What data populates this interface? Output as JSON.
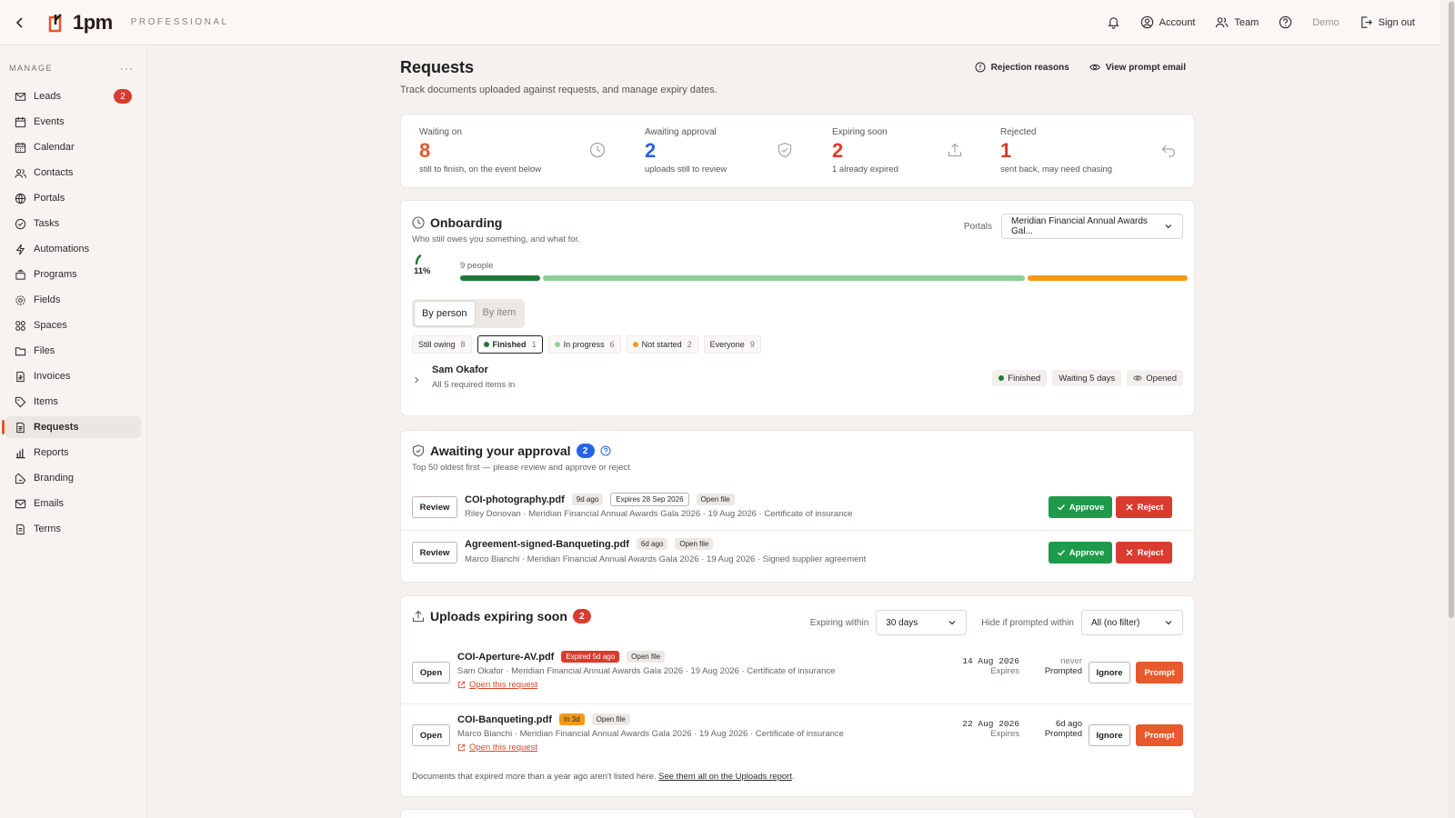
{
  "topbar": {
    "logo_text": "1pm",
    "logo_sub": "PROFESSIONAL",
    "account": "Account",
    "team": "Team",
    "demo": "Demo",
    "sign_out": "Sign out"
  },
  "sidebar": {
    "section": "MANAGE",
    "more": "···",
    "items": [
      {
        "label": "Leads",
        "badge": "2"
      },
      {
        "label": "Events"
      },
      {
        "label": "Calendar"
      },
      {
        "label": "Contacts"
      },
      {
        "label": "Portals"
      },
      {
        "label": "Tasks"
      },
      {
        "label": "Automations"
      },
      {
        "label": "Programs"
      },
      {
        "label": "Fields"
      },
      {
        "label": "Spaces"
      },
      {
        "label": "Files"
      },
      {
        "label": "Invoices"
      },
      {
        "label": "Items"
      },
      {
        "label": "Requests"
      },
      {
        "label": "Reports"
      },
      {
        "label": "Branding"
      },
      {
        "label": "Emails"
      },
      {
        "label": "Terms"
      }
    ]
  },
  "page": {
    "title": "Requests",
    "subtitle": "Track documents uploaded against requests, and manage expiry dates.",
    "rejection_reasons": "Rejection reasons",
    "view_prompt_email": "View prompt email"
  },
  "stats": [
    {
      "label": "Waiting on",
      "value": "8",
      "desc": "still to finish, on the event below",
      "color": "#e1572b"
    },
    {
      "label": "Awaiting approval",
      "value": "2",
      "desc": "uploads still to review",
      "color": "#2563eb"
    },
    {
      "label": "Expiring soon",
      "value": "2",
      "desc": "1 already expired",
      "color": "#d93b2f"
    },
    {
      "label": "Rejected",
      "value": "1",
      "desc": "sent back, may need chasing",
      "color": "#d93b2f"
    }
  ],
  "onboarding": {
    "title": "Onboarding",
    "subtitle": "Who still owes you something, and what for.",
    "portals_label": "Portals",
    "portal_value": "Meridian Financial Annual Awards Gal...",
    "progress_pct": "11%",
    "progress_value": 0.11,
    "people": "9 people",
    "bar": {
      "finished": 1,
      "in_progress": 6,
      "not_started": 2
    },
    "toggle": {
      "by_person": "By person",
      "by_item": "By item"
    },
    "filters": [
      {
        "label": "Still owing",
        "count": "8"
      },
      {
        "label": "Finished",
        "count": "1"
      },
      {
        "label": "In progress",
        "count": "6"
      },
      {
        "label": "Not started",
        "count": "2"
      },
      {
        "label": "Everyone",
        "count": "9"
      }
    ],
    "person": {
      "name": "Sam Okafor",
      "sub": "All 5 required items in",
      "status": "Finished",
      "waiting": "Waiting 5 days",
      "opened": "Opened"
    }
  },
  "approval": {
    "title": "Awaiting your approval",
    "count": "2",
    "subtitle": "Top 50 oldest first — please review and approve or reject",
    "review_label": "Review",
    "approve_label": "Approve",
    "reject_label": "Reject",
    "rows": [
      {
        "file": "COI-photography.pdf",
        "age": "9d ago",
        "expires": "Expires 28 Sep 2026",
        "open_file": "Open file",
        "meta": "Riley Donovan · Meridian Financial Annual Awards Gala 2026 · 19 Aug 2026 · Certificate of insurance"
      },
      {
        "file": "Agreement-signed-Banqueting.pdf",
        "age": "6d ago",
        "open_file": "Open file",
        "meta": "Marco Bianchi · Meridian Financial Annual Awards Gala 2026 · 19 Aug 2026 · Signed supplier agreement"
      }
    ]
  },
  "expiring": {
    "title": "Uploads expiring soon",
    "count": "2",
    "within_label": "Expiring within",
    "within_value": "30 days",
    "hide_label": "Hide if prompted within",
    "hide_value": "All (no filter)",
    "open_label": "Open",
    "ignore_label": "Ignore",
    "prompt_label": "Prompt",
    "expires_label": "Expires",
    "prompted_label": "Prompted",
    "open_request": "Open this request",
    "rows": [
      {
        "file": "COI-Aperture-AV.pdf",
        "badge": "Expired 5d ago",
        "open_file": "Open file",
        "meta": "Sam Okafor · Meridian Financial Annual Awards Gala 2026 · 19 Aug 2026 · Certificate of insurance",
        "date": "14 Aug 2026",
        "prompted": "never"
      },
      {
        "file": "COI-Banqueting.pdf",
        "badge": "In 3d",
        "open_file": "Open file",
        "meta": "Marco Bianchi · Meridian Financial Annual Awards Gala 2026 · 19 Aug 2026 · Certificate of insurance",
        "date": "22 Aug 2026",
        "prompted": "6d ago"
      }
    ],
    "footnote": "Documents that expired more than a year ago aren't listed here.",
    "footnote_link": "See them all on the Uploads report"
  }
}
